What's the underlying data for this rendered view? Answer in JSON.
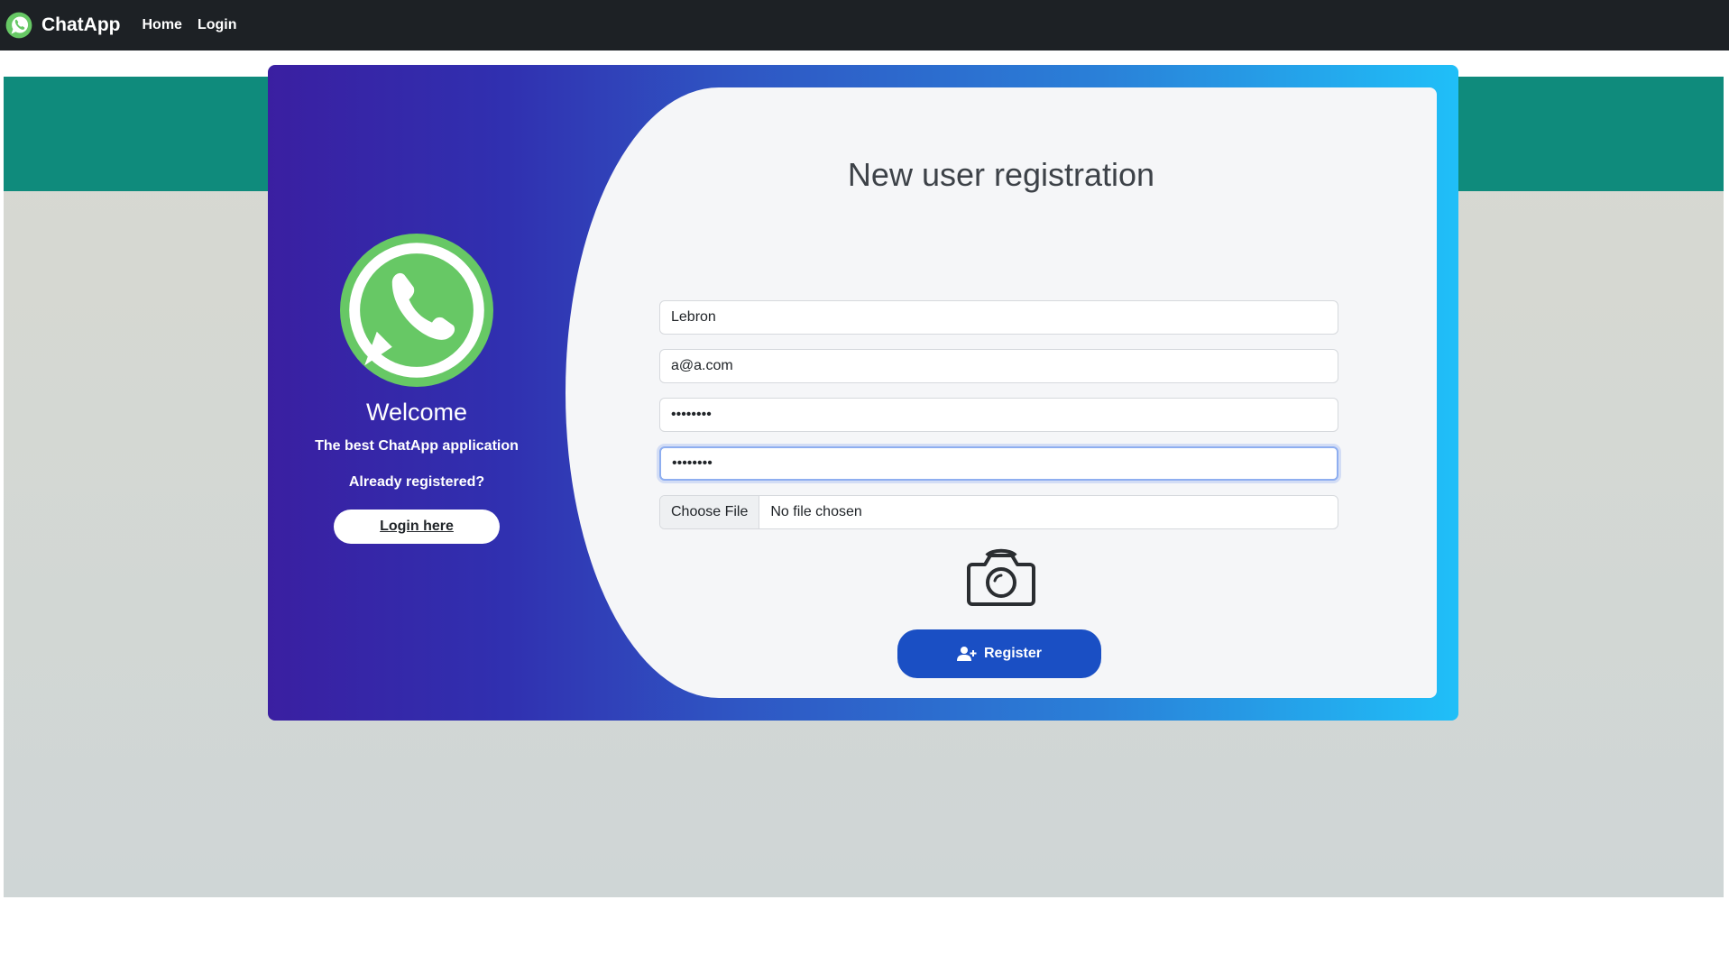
{
  "navbar": {
    "brand": "ChatApp",
    "links": {
      "home": "Home",
      "login": "Login"
    }
  },
  "welcome_panel": {
    "heading": "Welcome",
    "tagline": "The best ChatApp application",
    "prompt": "Already registered?",
    "login_button": "Login here"
  },
  "form": {
    "title": "New user registration",
    "name_value": "Lebron",
    "email_value": "a@a.com",
    "password_value": "••••••••",
    "confirm_password_value": "••••••••",
    "file_button": "Choose File",
    "file_status": "No file chosen",
    "register_button": "Register"
  },
  "icons": {
    "brand": "whatsapp-logo-icon",
    "welcome": "whatsapp-logo-icon",
    "photo": "camera-icon",
    "register": "user-plus-icon"
  },
  "colors": {
    "navbar": "#1d2125",
    "teal_band": "#0f8b7c",
    "card_gradient_start": "#3a1fa1",
    "card_gradient_end": "#20bff8",
    "register_button": "#1a4fc4",
    "whatsapp_green": "#67c865"
  }
}
